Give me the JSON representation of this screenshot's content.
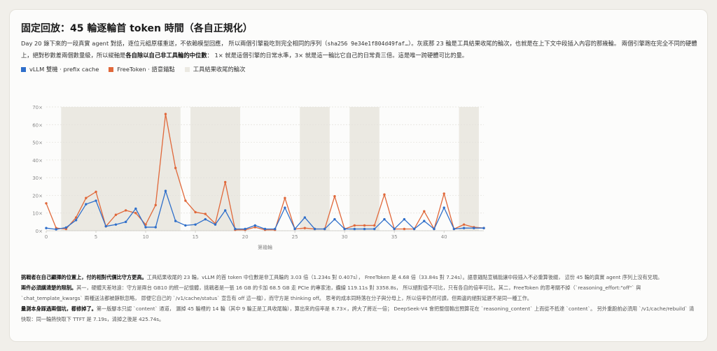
{
  "title": "固定回放：45 輪逐輪首 token 時間（各自正規化）",
  "description": {
    "p1": "Day 20 錄下來的一段真實 agent 對話，逐位元組原樣重送，不依賴模型回應， 所以兩個引擎能吃到完全相同的序列（",
    "hash": "sha256 9e34e1f804d49faf…",
    "p2": "）。灰底那 23 輪是工具結果收尾的輪次，也就是在上下文中段插入內容的那幾輪。 兩個引擎跑在完全不同的硬體上，絕對秒數差兩個數量級，所以縱軸是",
    "bold": "各自除以自己非工具輪的中位數",
    "p3": "： 1× 就是這個引擎的日常水準，3× 就是這一輪比它自己的日常貴三倍。這是唯一跨硬體可比的量。"
  },
  "legend": {
    "vllm": "vLLM 雙機 · prefix cache",
    "free": "FreeToken · 語意錨點",
    "band": "工具結果收尾的輪次"
  },
  "colors": {
    "vllm": "#2f6fca",
    "free": "#e0683a",
    "band": "#ebe9e2",
    "grid": "#e2e0da",
    "axis_text": "#8a8a8a"
  },
  "chart_data": {
    "type": "line",
    "xlabel": "第幾輪",
    "ylabel": "",
    "xlim": [
      0,
      44
    ],
    "ylim": [
      0,
      70
    ],
    "x_ticks": [
      0,
      5,
      10,
      15,
      20,
      25,
      30,
      35,
      40
    ],
    "y_ticks": [
      0,
      10,
      20,
      30,
      40,
      50,
      60,
      70
    ],
    "y_tick_labels": [
      "0×",
      "10×",
      "20×",
      "30×",
      "40×",
      "50×",
      "60×",
      "70×"
    ],
    "tool_rounds": [
      2,
      3,
      4,
      5,
      6,
      7,
      8,
      9,
      10,
      11,
      12,
      13,
      15,
      16,
      17,
      18,
      19,
      26,
      27,
      28,
      31,
      32,
      33,
      42,
      43
    ],
    "x": [
      0,
      1,
      2,
      3,
      4,
      5,
      6,
      7,
      8,
      9,
      10,
      11,
      12,
      13,
      14,
      15,
      16,
      17,
      18,
      19,
      20,
      21,
      22,
      23,
      24,
      25,
      26,
      27,
      28,
      29,
      30,
      31,
      32,
      33,
      34,
      35,
      36,
      37,
      38,
      39,
      40,
      41,
      42,
      43,
      44
    ],
    "series": [
      {
        "name": "vLLM 雙機 · prefix cache",
        "values": [
          1.5,
          0.8,
          1.8,
          6,
          15,
          17,
          2.5,
          3.5,
          5,
          12.5,
          2,
          2,
          22.5,
          5.5,
          3,
          3.5,
          6.5,
          3.5,
          11.5,
          1,
          1,
          3,
          1,
          1,
          13,
          1,
          7.5,
          1,
          1,
          6.5,
          1,
          1,
          1,
          1,
          6.5,
          1,
          6.5,
          1,
          5.5,
          1,
          13,
          1,
          1.5,
          1.5,
          1.5
        ]
      },
      {
        "name": "FreeToken · 語意錨點",
        "values": [
          15.5,
          1.5,
          1,
          7.5,
          18.5,
          22,
          2.5,
          9,
          11.5,
          10,
          3.5,
          14.5,
          66,
          35.5,
          17,
          10.5,
          9.5,
          4,
          27.5,
          0.5,
          0.5,
          2,
          0.5,
          0.5,
          18.5,
          1,
          1.5,
          1,
          1,
          19.5,
          1,
          3,
          3,
          3,
          20.5,
          1,
          1,
          1,
          11,
          1,
          21,
          1,
          3.5,
          2,
          1.5
        ]
      }
    ]
  },
  "notes": {
    "n1_bold": "挑戰者在自己顯擇的位置上，付的相對代價比守方更高。",
    "n1": "工具結果收尾的 23 輪，vLLM 的首 token 中位數是非工具輪的 3.03 倍（1.234s 對 0.407s）， FreeToken 是 4.68 倍（33.84s 對 7.24s）。語意錨點宣稱能讓中段插入不必重算後綴， 這份 45 輪的真實 agent 序列上沒有兌現。",
    "n2_bold": "兩件必須講清楚的限制。",
    "n2": "其一，硬體天差地遠：守方是兩台 GB10 的統一記憶體，挑戰者是一張 16 GB 的卡加 68.5 GB 走 PCIe 的專家池，纜線 119.11s 對 3358.8s， 所以絕對值不可比，只有各自的倍率可比。其二，FreeToken 的思考關不掉（`reasoning_effort:\"off\"` 與 `chat_template_kwargs` 兩種送法都被靜默忽略， 即便它自己的 `/v1/cache/status` 宣告有 off 這一檔），而守方是 thinking off。 思考的成本同時落在分子與分母上，所以倍率仍然可讀，但兩邊的絕對延遲不是同一種工作。",
    "n3_bold": "量測本身踩過兩個坑，都修掉了。",
    "n3": "第一版腳本只認 `content` 通道， 漏掉 45 輪裡的 14 輪（其中 9 輪正是工具收尾輪），算出來的倍率是 8.73×，誇大了將近一倍； DeepSeek-V4 會把整個輸出預算花在 `reasoning_content` 上而從不抵達 `content`。 另外重跑前必須用 `/v1/cache/rebuild` 清快取：同一輪熱快取下 TTFT 是 7.19s，清掉之後是 425.74s。"
  }
}
